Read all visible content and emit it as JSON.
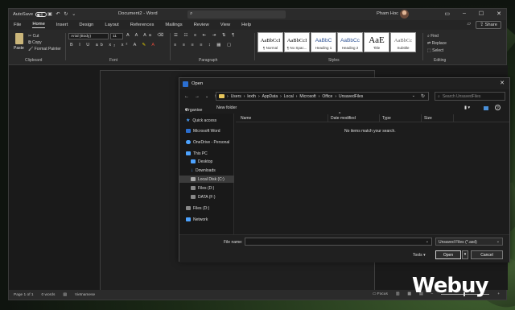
{
  "word": {
    "autosave_label": "AutoSave",
    "toggle_state": "Off",
    "doc_title": "Document2 - Word",
    "user_name": "Pham Hoc",
    "share_label": "Share",
    "menu": [
      "File",
      "Home",
      "Insert",
      "Design",
      "Layout",
      "References",
      "Mailings",
      "Review",
      "View",
      "Help"
    ],
    "active_menu": "Home",
    "clipboard": {
      "paste": "Paste",
      "cut": "Cut",
      "copy": "Copy",
      "format_painter": "Format Painter",
      "label": "Clipboard"
    },
    "font": {
      "name": "Arial (Body)",
      "size": "11",
      "label": "Font"
    },
    "paragraph_label": "Paragraph",
    "styles": [
      {
        "sample": "AaBbCcI",
        "name": "¶ Normal"
      },
      {
        "sample": "AaBbCcI",
        "name": "¶ No Spac..."
      },
      {
        "sample": "AaBbC",
        "name": "Heading 1"
      },
      {
        "sample": "AaBbCc",
        "name": "Heading 2"
      },
      {
        "sample": "AaE",
        "name": "Title"
      },
      {
        "sample": "AaBbCc",
        "name": "Subtitle"
      }
    ],
    "styles_label": "Styles",
    "editing": {
      "find": "Find",
      "replace": "Replace",
      "select": "Select",
      "label": "Editing"
    },
    "status": {
      "page": "Page 1 of 1",
      "words": "0 words",
      "language": "Vietnamese",
      "focus": "Focus"
    }
  },
  "dialog": {
    "title": "Open",
    "path": [
      "Users",
      "lexth",
      "AppData",
      "Local",
      "Microsoft",
      "Office",
      "UnsavedFiles"
    ],
    "search_placeholder": "Search UnsavedFiles",
    "organise": "Organise",
    "new_folder": "New folder",
    "nav": [
      "Quick access",
      "Microsoft Word",
      "OneDrive - Personal",
      "This PC",
      "Desktop",
      "Downloads",
      "Local Disk (C:)",
      "Files (D:)",
      "DATA (F:)",
      "Files (D:)",
      "Network"
    ],
    "selected_nav": "Local Disk (C:)",
    "columns": [
      "Name",
      "Date modified",
      "Type",
      "Size"
    ],
    "empty_message": "No items match your search.",
    "file_name_label": "File name:",
    "file_name_value": "",
    "file_type": "Unsaved Files (*.asd)",
    "tools": "Tools",
    "open": "Open",
    "cancel": "Cancel"
  },
  "watermark": "Webuy"
}
